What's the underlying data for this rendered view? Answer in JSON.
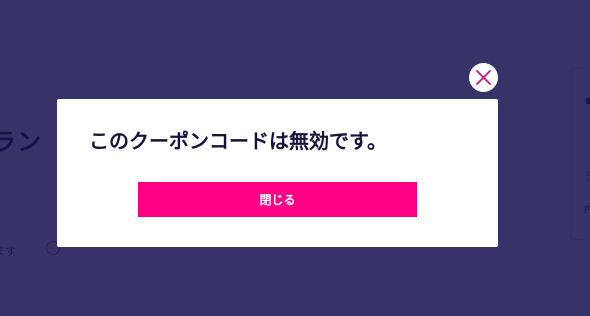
{
  "background": {
    "heading_fragment": "ラン",
    "note_fragment": "ます",
    "side_letters": [
      "ラ",
      "P"
    ]
  },
  "modal": {
    "message": "このクーポンコードは無効です。",
    "button_label": "閉じる",
    "close_icon": "close-icon"
  },
  "colors": {
    "overlay": "#16104e",
    "button": "#ff0084",
    "close_icon": "#d4137f",
    "message_text": "#17133e"
  }
}
